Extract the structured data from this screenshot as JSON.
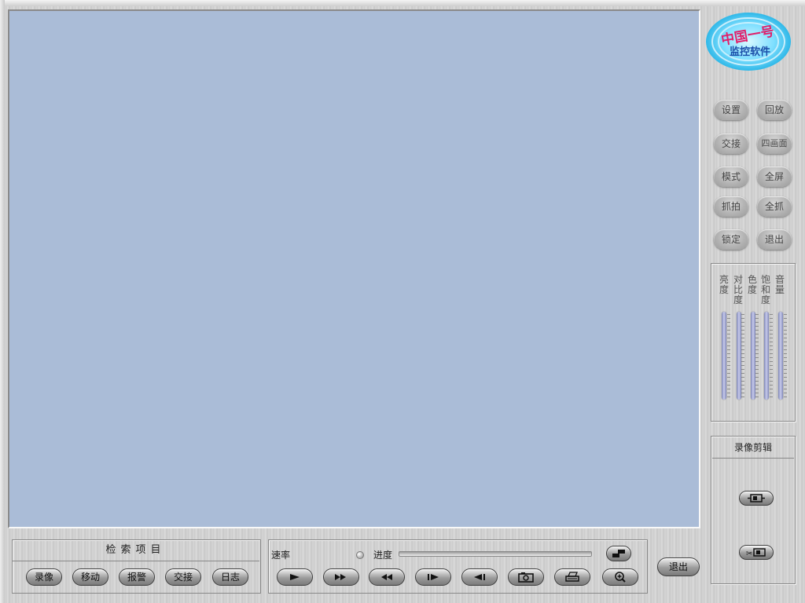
{
  "logo": {
    "top_text": "中国一号",
    "bottom_text": "监控软件"
  },
  "side_buttons": [
    {
      "label": "设置"
    },
    {
      "label": "回放"
    },
    {
      "label": "交接"
    },
    {
      "label": "四画面"
    },
    {
      "label": "模式"
    },
    {
      "label": "全屏"
    },
    {
      "label": "抓拍"
    },
    {
      "label": "全抓"
    },
    {
      "label": "锁定"
    },
    {
      "label": "退出"
    }
  ],
  "adjust": [
    {
      "label": "亮度"
    },
    {
      "label": "对比度"
    },
    {
      "label": "色度"
    },
    {
      "label": "饱和度"
    },
    {
      "label": "音量"
    }
  ],
  "record_edit": {
    "title": "录像剪辑"
  },
  "search": {
    "title": "检索项目",
    "buttons": [
      {
        "label": "录像"
      },
      {
        "label": "移动"
      },
      {
        "label": "报警"
      },
      {
        "label": "交接"
      },
      {
        "label": "日志"
      }
    ]
  },
  "playback": {
    "rate_label": "速率",
    "progress_label": "进度",
    "controls": [
      {
        "icon": "play-icon"
      },
      {
        "icon": "fast-forward-icon"
      },
      {
        "icon": "rewind-icon"
      },
      {
        "icon": "step-forward-icon"
      },
      {
        "icon": "step-back-icon"
      },
      {
        "icon": "camera-icon"
      },
      {
        "icon": "print-icon"
      },
      {
        "icon": "zoom-in-icon"
      }
    ]
  },
  "exit_button": {
    "label": "退出"
  }
}
